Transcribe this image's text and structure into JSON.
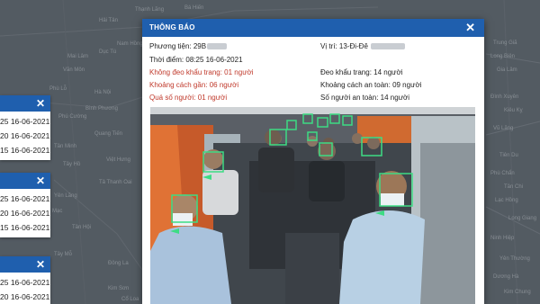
{
  "map": {
    "labels": [
      "Thạnh Lãng",
      "Bá Hiến",
      "Hải Tân",
      "Vạn Nội",
      "Nam Hồng",
      "Mai Lâm",
      "Dục Tú",
      "Đa Phúc",
      "Bình Phương",
      "Phù Lỗ",
      "Phú Cường",
      "Quang Tiến",
      "Tân Minh",
      "Tây Hồ",
      "Tả Thanh Oai",
      "Yên Lãng",
      "Liên Mạc",
      "Tân Hội",
      "Tây Mỗ",
      "Đông La",
      "Kim Sơn",
      "Cổ Loa",
      "Hà Nội",
      "Việt Hưng",
      "Long Biên",
      "Gia Lâm",
      "Đình Xuyên",
      "Kiêu Kỵ",
      "Vũ Lăng",
      "Tiên Du",
      "Phù Chẩn",
      "Tân Chi",
      "Lạc Hồng",
      "Long Giang",
      "Ninh Hiệp",
      "Yên Thường",
      "Dương Hà",
      "Kim Chung",
      "Trung Giã",
      "Văn Môn"
    ]
  },
  "left_cards": [
    {
      "rows": [
        "25 16-06-2021",
        "20 16-06-2021",
        "15 16-06-2021"
      ]
    },
    {
      "rows": [
        "25 16-06-2021",
        "20 16-06-2021",
        "15 16-06-2021"
      ]
    },
    {
      "rows": [
        "25 16-06-2021",
        "20 16-06-2021"
      ]
    }
  ],
  "dialog": {
    "title": "THÔNG BÁO",
    "vehicle_label": "Phương tiện: 29B",
    "time_label": "Thời điểm: 08:25 16-06-2021",
    "location_label": "Vị trí: 13-Đi-Đê",
    "no_mask": "Không đeo khẩu trang: 01 người",
    "mask": "Đeo khẩu trang: 14 người",
    "near_distance": "Khoảng cách gần: 06 người",
    "safe_distance": "Khoảng cách an toàn: 09 người",
    "over_capacity": "Quá số người: 01 người",
    "safe_count": "Số người an toàn: 14 người"
  },
  "colors": {
    "header_blue": "#1f5fae",
    "alert_red": "#c0392b",
    "detect_green": "#3ddc84"
  }
}
